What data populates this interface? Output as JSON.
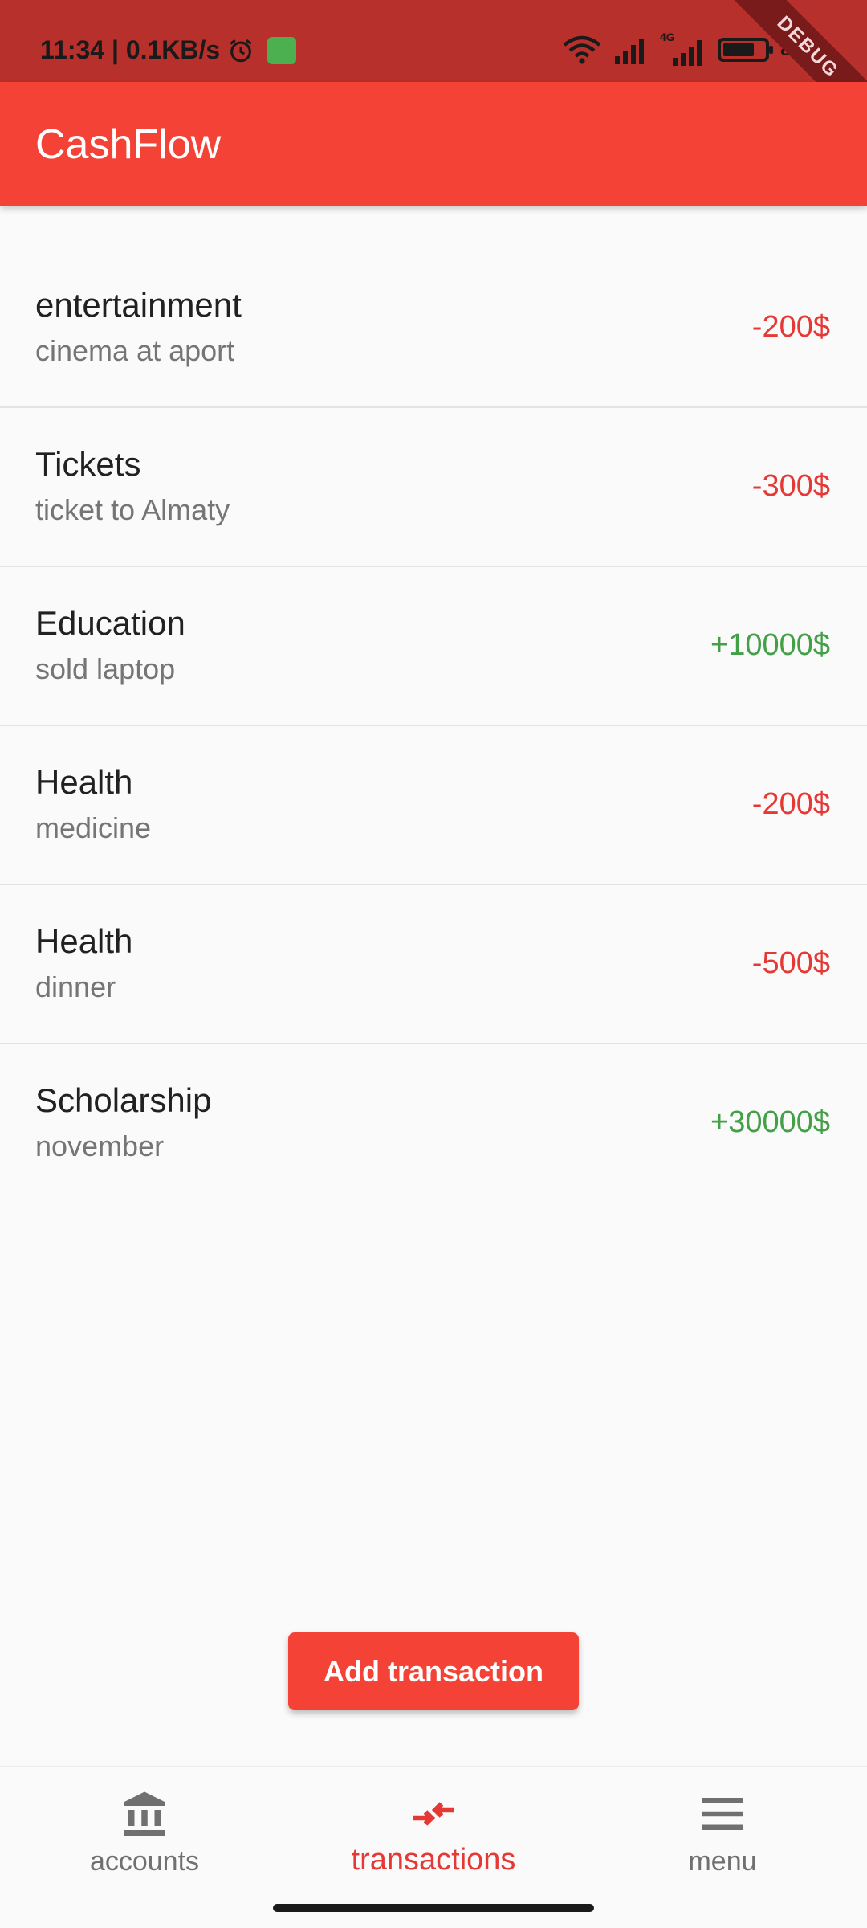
{
  "status_bar": {
    "time_speed": "11:34 | 0.1KB/s",
    "battery_text": "81%",
    "network_label": "4G",
    "icons": [
      "alarm-icon",
      "app-notification-icon",
      "wifi-icon",
      "signal-icon",
      "signal-4g-icon",
      "battery-icon"
    ]
  },
  "debug_banner": "DEBUG",
  "app_bar": {
    "title": "CashFlow"
  },
  "transactions": [
    {
      "title": "entertainment",
      "subtitle": "cinema at aport",
      "amount": "-200$",
      "type": "expense"
    },
    {
      "title": "Tickets",
      "subtitle": "ticket to Almaty",
      "amount": "-300$",
      "type": "expense"
    },
    {
      "title": "Education",
      "subtitle": "sold laptop",
      "amount": "+10000$",
      "type": "income"
    },
    {
      "title": "Health",
      "subtitle": "medicine",
      "amount": "-200$",
      "type": "expense"
    },
    {
      "title": "Health",
      "subtitle": "dinner",
      "amount": "-500$",
      "type": "expense"
    },
    {
      "title": "Scholarship",
      "subtitle": "november",
      "amount": "+30000$",
      "type": "income"
    }
  ],
  "add_button": {
    "label": "Add transaction"
  },
  "bottom_nav": {
    "items": [
      {
        "label": "accounts",
        "icon": "bank-icon",
        "active": false
      },
      {
        "label": "transactions",
        "icon": "compare-arrows-icon",
        "active": true
      },
      {
        "label": "menu",
        "icon": "menu-icon",
        "active": false
      }
    ]
  },
  "colors": {
    "primary": "#f44336",
    "status_bar": "#b8302b",
    "expense": "#e53935",
    "income": "#43a047",
    "background": "#fafafa"
  }
}
